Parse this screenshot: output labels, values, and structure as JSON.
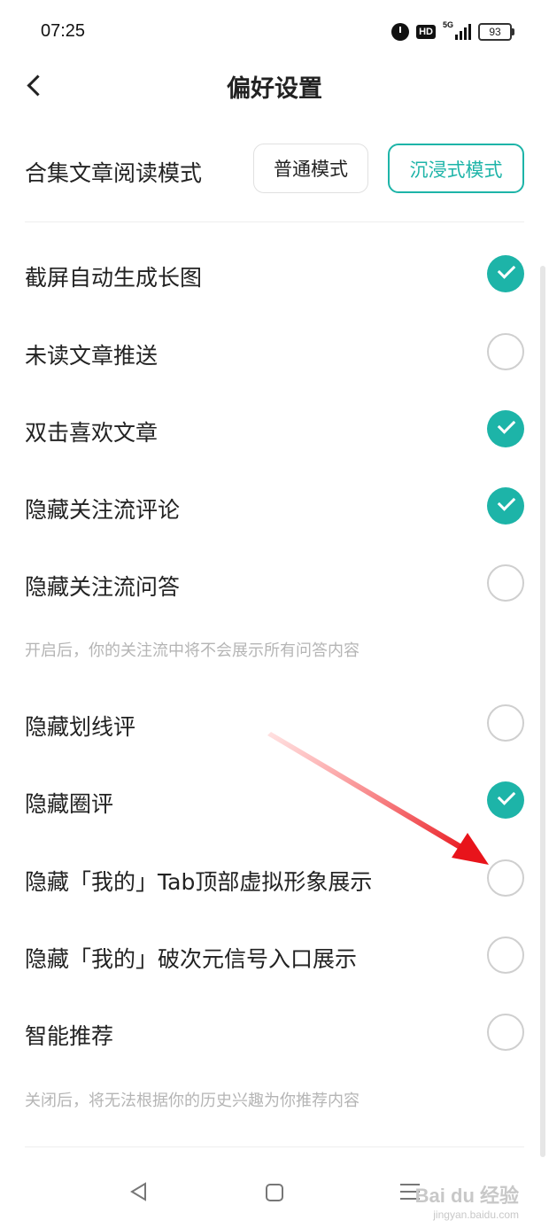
{
  "status_bar": {
    "time": "07:25",
    "hd_label": "HD",
    "network_label": "5G",
    "battery": "93"
  },
  "header": {
    "title": "偏好设置"
  },
  "reading_mode": {
    "label": "合集文章阅读模式",
    "options": [
      "普通模式",
      "沉浸式模式"
    ],
    "selected": "沉浸式模式"
  },
  "settings": [
    {
      "label": "截屏自动生成长图",
      "checked": true
    },
    {
      "label": "未读文章推送",
      "checked": false
    },
    {
      "label": "双击喜欢文章",
      "checked": true
    },
    {
      "label": "隐藏关注流评论",
      "checked": true
    },
    {
      "label": "隐藏关注流问答",
      "checked": false
    },
    {
      "label": "隐藏划线评",
      "checked": false
    },
    {
      "label": "隐藏圈评",
      "checked": true
    },
    {
      "label": "隐藏「我的」Tab顶部虚拟形象展示",
      "checked": false
    },
    {
      "label": "隐藏「我的」破次元信号入口展示",
      "checked": false
    },
    {
      "label": "智能推荐",
      "checked": false
    }
  ],
  "hints": {
    "qa_hint": "开启后，你的关注流中将不会展示所有问答内容",
    "recommend_hint": "关闭后，将无法根据你的历史兴趣为你推荐内容"
  },
  "watermark": {
    "main": "Bai du 经验",
    "sub": "jingyan.baidu.com"
  },
  "colors": {
    "accent": "#1db4a8",
    "annotation_arrow": "#e8141b"
  }
}
